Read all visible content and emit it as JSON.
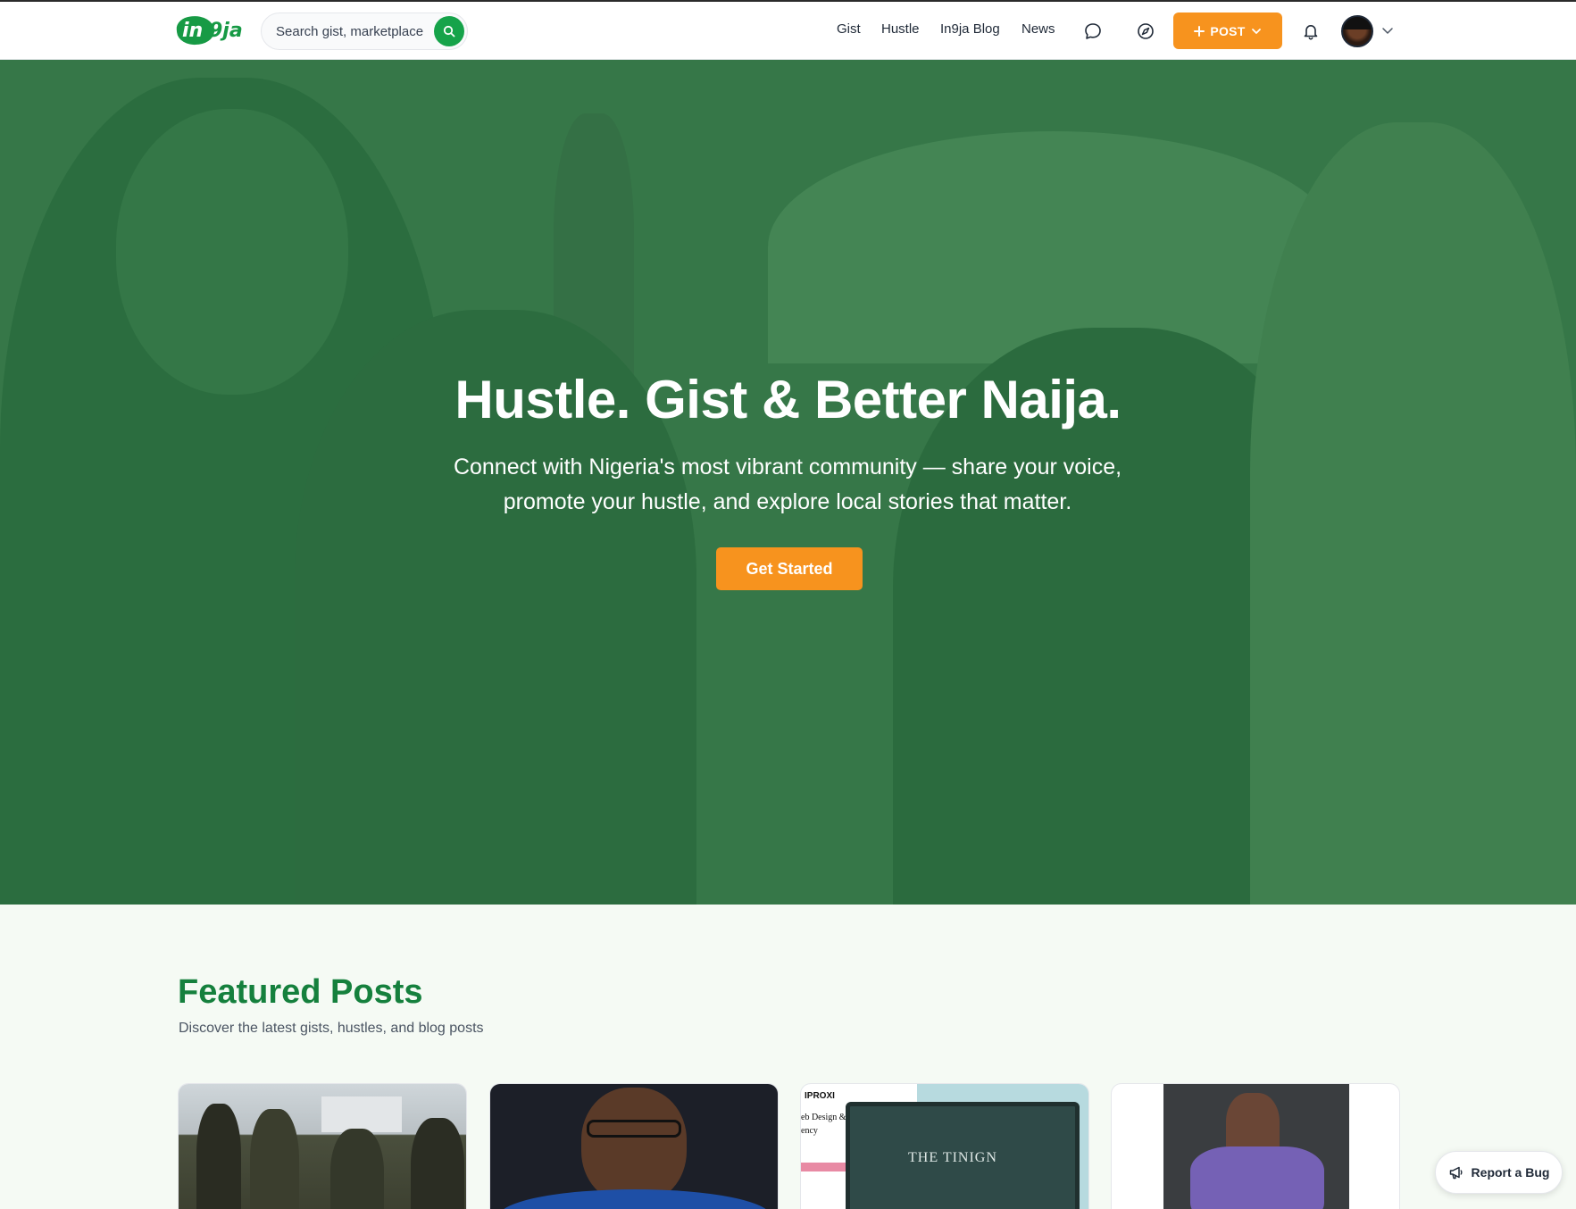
{
  "brand": {
    "logo_part1": "in",
    "logo_part2": "9ja",
    "primary_color": "#16a34a",
    "accent_color": "#f7931e"
  },
  "header": {
    "search": {
      "placeholder": "Search gist, marketplace",
      "icon": "search-icon"
    },
    "nav": [
      {
        "label": "Gist"
      },
      {
        "label": "Hustle"
      },
      {
        "label": "In9ja Blog"
      },
      {
        "label": "News"
      }
    ],
    "icons": [
      "chat-icon",
      "compass-icon",
      "bell-icon",
      "chevron-down-icon"
    ],
    "post_button": {
      "label": "POST"
    }
  },
  "hero": {
    "title": "Hustle. Gist & Better Naija.",
    "subtitle": "Connect with Nigeria's most vibrant community — share your voice, promote your hustle, and explore local stories that matter.",
    "cta_label": "Get Started"
  },
  "featured": {
    "title": "Featured Posts",
    "subtitle": "Discover the latest gists, hustles, and blog posts",
    "cards": [
      {
        "image": "police-officers-photo"
      },
      {
        "image": "man-in-blue-suit-photo"
      },
      {
        "image": "web-design-agency-screenshot",
        "image_text": [
          "IPROXI",
          "eb Design & Digital",
          "ency",
          "THE TINIGN"
        ]
      },
      {
        "image": "dancers-photo"
      }
    ]
  },
  "report_bug": {
    "label": "Report a Bug"
  }
}
